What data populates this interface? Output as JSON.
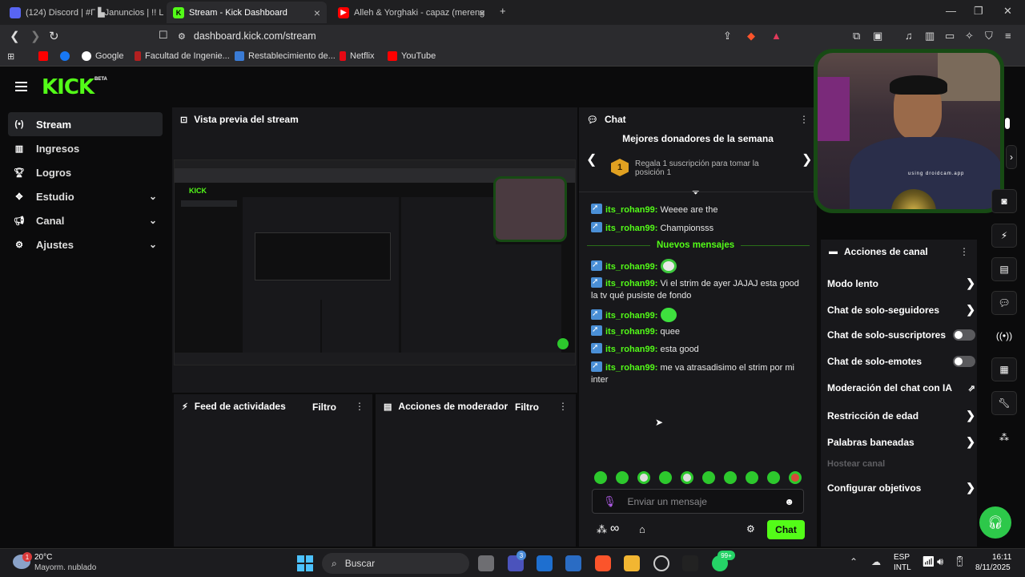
{
  "browser": {
    "tabs": [
      {
        "label": "(124) Discord | #Γ ▙Januncios | !! LA",
        "badge": "124"
      },
      {
        "label": "Stream - Kick Dashboard"
      },
      {
        "label": "Alleh & Yorghaki - capaz (mereng"
      }
    ],
    "url": "dashboard.kick.com/stream",
    "brave_badge": "1",
    "bookmarks": [
      "Google",
      "Facultad de Ingenie...",
      "Restablecimiento de...",
      "Netflix",
      "YouTube"
    ]
  },
  "kick": {
    "logo": "KICK",
    "beta": "BETA",
    "sidebar": [
      {
        "label": "Stream",
        "icon": "broadcast-icon"
      },
      {
        "label": "Ingresos",
        "icon": "chart-icon"
      },
      {
        "label": "Logros",
        "icon": "trophy-icon"
      },
      {
        "label": "Estudio",
        "icon": "studio-icon"
      },
      {
        "label": "Canal",
        "icon": "channel-icon"
      },
      {
        "label": "Ajustes",
        "icon": "gear-icon"
      }
    ],
    "preview": {
      "title": "Vista previa del stream"
    },
    "feed": {
      "title": "Feed de actividades",
      "filter": "Filtro"
    },
    "mod": {
      "title": "Acciones de moderador",
      "filter": "Filtro"
    },
    "chat": {
      "title": "Chat",
      "donors_title": "Mejores donadores de la semana",
      "donor_rank": "1",
      "donor_text": "Regala 1 suscripción para tomar la posición 1",
      "new_messages": "Nuevos mensajes",
      "messages_before": [
        {
          "user": "its_rohan99:",
          "text": "Weeee are the"
        },
        {
          "user": "its_rohan99:",
          "text": "Championsss"
        }
      ],
      "messages_after": [
        {
          "user": "its_rohan99:",
          "text": ""
        },
        {
          "user": "its_rohan99:",
          "text": "Vi el strim de ayer JAJAJ esta good la tv qué pusiste de fondo"
        },
        {
          "user": "its_rohan99:",
          "text": ""
        },
        {
          "user": "its_rohan99:",
          "text": "quee"
        },
        {
          "user": "its_rohan99:",
          "text": "esta good"
        },
        {
          "user": "its_rohan99:",
          "text": "me va atrasadisimo el strim por mi inter"
        }
      ],
      "input_placeholder": "Enviar un mensaje",
      "send_label": "Chat"
    },
    "channel_actions": {
      "title": "Acciones de canal",
      "items": [
        {
          "label": "Modo lento"
        },
        {
          "label": "Chat de solo-seguidores"
        },
        {
          "label": "Chat de solo-suscriptores"
        },
        {
          "label": "Chat de solo-emotes"
        },
        {
          "label": "Moderación del chat con IA"
        },
        {
          "label": "Restricción de edad"
        },
        {
          "label": "Palabras baneadas"
        },
        {
          "label": "Hostear canal"
        },
        {
          "label": "Configurar objetivos"
        }
      ]
    },
    "webcam_text": "using droidcam.app"
  },
  "taskbar": {
    "weather_temp": "20°C",
    "weather_desc": "Mayorm. nublado",
    "weather_badge": "1",
    "search_placeholder": "Buscar",
    "lang": "ESP",
    "lang2": "INTL",
    "time": "16:11",
    "date": "8/11/2025",
    "badge_teams": "3",
    "badge_whatsapp": "99+"
  },
  "colors": {
    "accent": "#53fc18",
    "bg": "#0b0b0c",
    "panel": "#18181b"
  }
}
